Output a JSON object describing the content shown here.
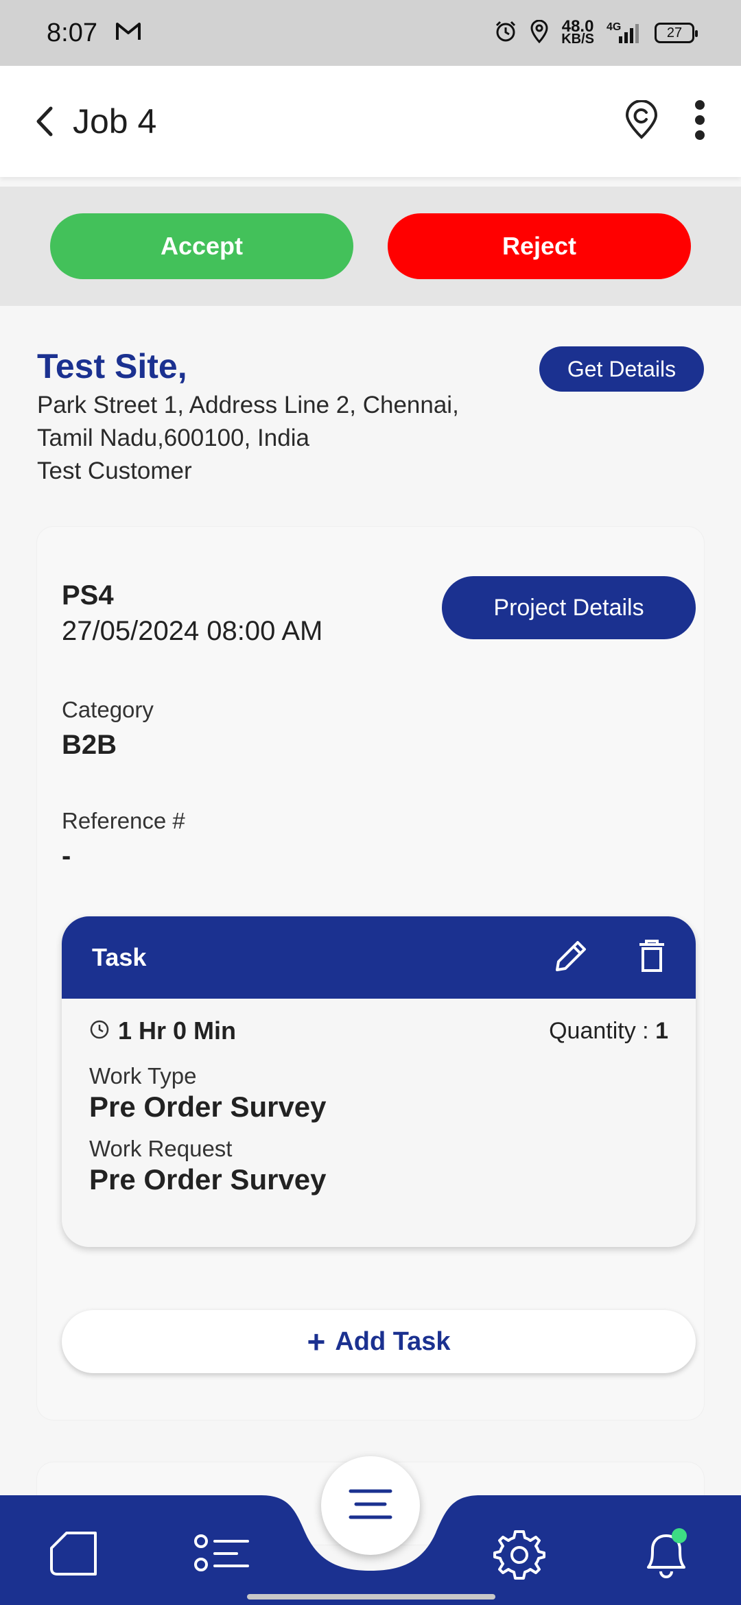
{
  "status_bar": {
    "time": "8:07",
    "net_speed_value": "48.0",
    "net_speed_unit": "KB/S",
    "network": "4G",
    "battery": "27"
  },
  "header": {
    "title": "Job 4",
    "icons": [
      "back-icon",
      "location-icon",
      "more-vertical-icon"
    ]
  },
  "actions": {
    "accept_label": "Accept",
    "reject_label": "Reject",
    "accept_color": "#43c15a",
    "reject_color": "#ff0000"
  },
  "site": {
    "title": "Test Site,",
    "address_line1": "Park Street 1, Address Line 2, Chennai,",
    "address_line2": "Tamil Nadu,600100, India",
    "customer": "Test Customer",
    "get_details_label": "Get Details"
  },
  "project": {
    "code": "PS4",
    "datetime": "27/05/2024 08:00 AM",
    "details_button_label": "Project Details",
    "category_label": "Category",
    "category_value": "B2B",
    "reference_label": "Reference #",
    "reference_value": "-"
  },
  "task": {
    "title": "Task",
    "duration": "1 Hr 0 Min",
    "quantity_label": "Quantity :",
    "quantity_value": "1",
    "work_type_label": "Work Type",
    "work_type_value": "Pre Order Survey",
    "work_request_label": "Work Request",
    "work_request_value": "Pre Order Survey",
    "add_task_label": "Add Task"
  },
  "bottom_nav": {
    "items": [
      "home-icon",
      "list-icon",
      "menu-icon",
      "settings-icon",
      "notification-bell-icon"
    ],
    "brand_color": "#1b3190",
    "badge_color": "#3ddc84"
  }
}
